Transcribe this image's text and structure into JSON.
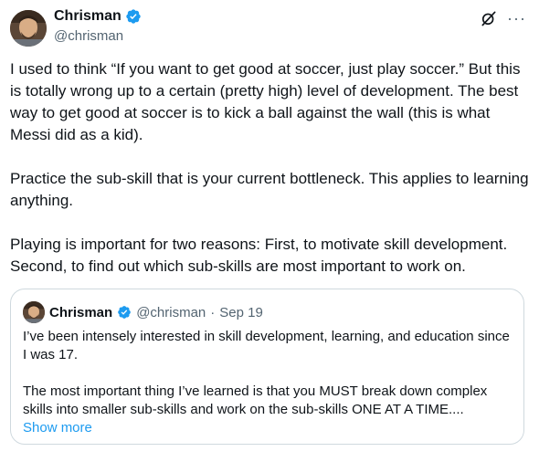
{
  "tweet": {
    "author": {
      "name": "Chrisman",
      "handle": "@chrisman",
      "avatar_icon": "avatar-photo",
      "verified_icon": "verified-badge-icon"
    },
    "top_icons": [
      "grok-icon",
      "more-icon"
    ],
    "more_glyph": "···",
    "paragraphs": [
      "I used to think “If you want to get good at soccer, just play soccer.” But this is totally wrong up to a certain (pretty high) level of development. The best way to get good at soccer is to kick a ball against the wall (this is what Messi did as a kid).",
      "Practice the sub-skill that is your current bottleneck. This applies to learning anything.",
      "Playing is important for two reasons: First, to motivate skill development. Second, to find out which sub-skills are most important to work on."
    ]
  },
  "quote": {
    "name": "Chrisman",
    "handle": "@chrisman",
    "separator": "·",
    "date": "Sep 19",
    "paragraphs": [
      "I’ve been intensely interested in skill development, learning, and education since I was 17.",
      "The most important thing I’ve learned is that you MUST break down complex skills into smaller sub-skills and work on the sub-skills ONE AT A TIME...."
    ],
    "show_more": "Show more"
  },
  "colors": {
    "text": "#0f1419",
    "secondary": "#536471",
    "link": "#1d9bf0",
    "verified": "#1d9bf0",
    "border": "#cfd9de"
  }
}
